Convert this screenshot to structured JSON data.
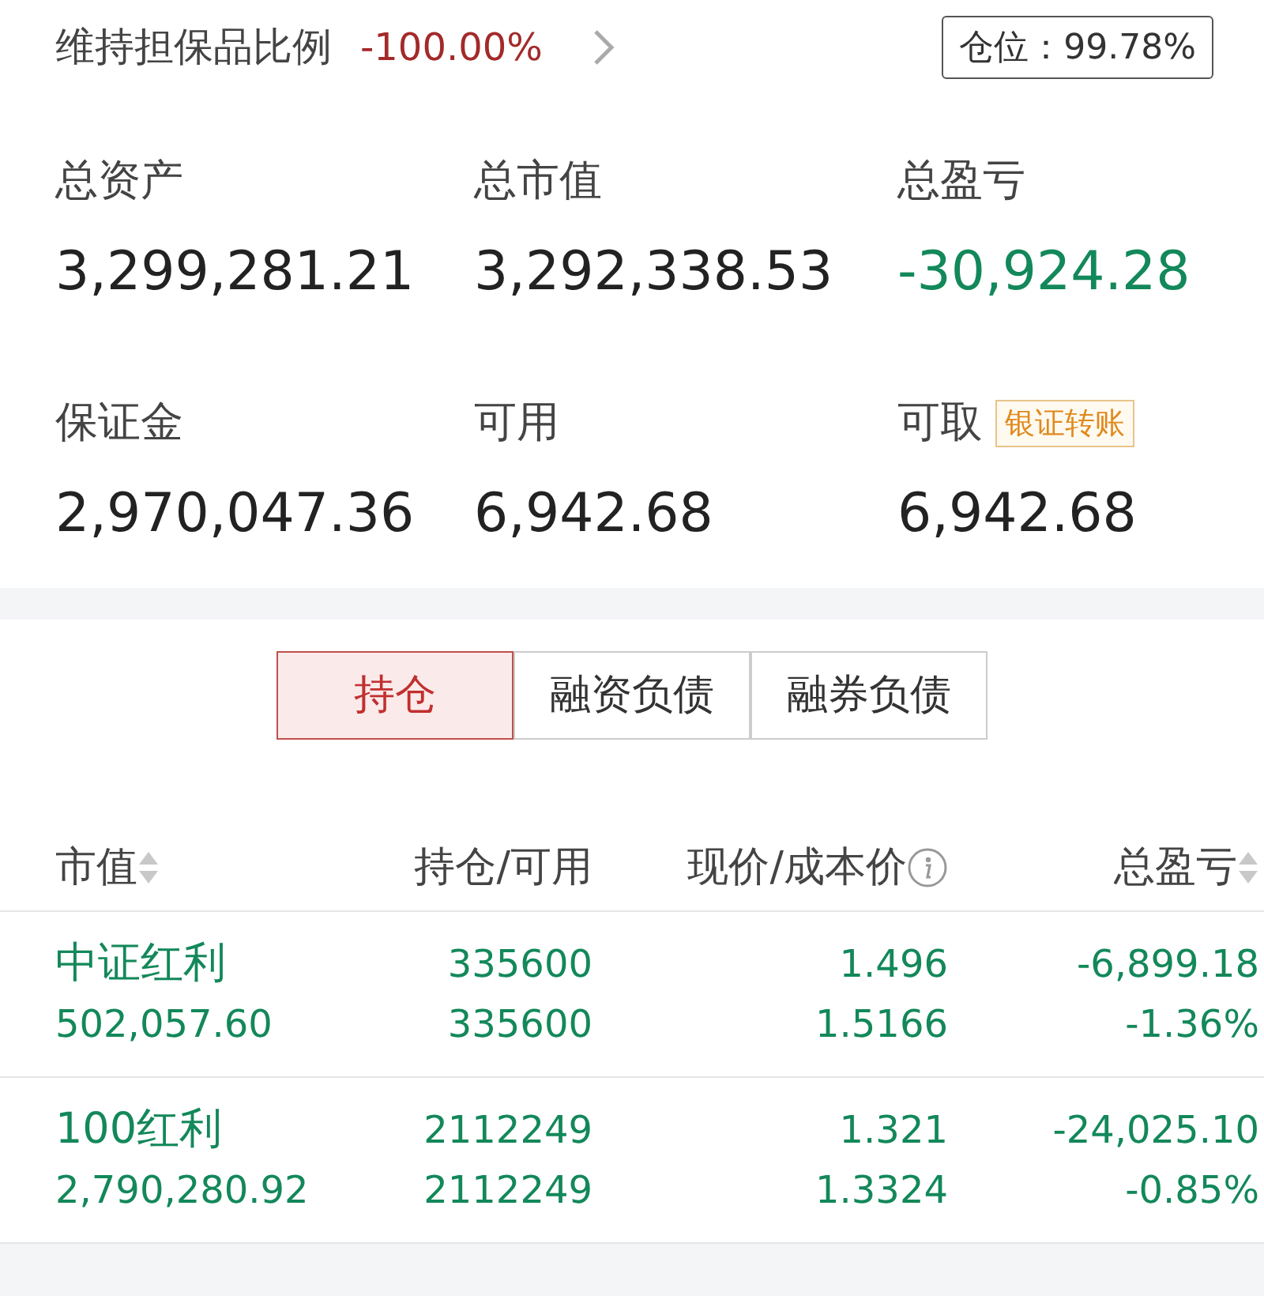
{
  "margin_ratio": {
    "label": "维持担保品比例",
    "value": "-100.00%"
  },
  "position_badge": "仓位：99.78%",
  "summary": [
    {
      "label": "总资产",
      "value": "3,299,281.21",
      "color": "#222222"
    },
    {
      "label": "总市值",
      "value": "3,292,338.53",
      "color": "#222222"
    },
    {
      "label": "总盈亏",
      "value": "-30,924.28",
      "color": "#13885a"
    },
    {
      "label": "保证金",
      "value": "2,970,047.36",
      "color": "#222222"
    },
    {
      "label": "可用",
      "value": "6,942.68",
      "color": "#222222"
    },
    {
      "label": "可取",
      "value": "6,942.68",
      "color": "#222222",
      "action": "银证转账"
    }
  ],
  "tabs": [
    {
      "label": "持仓",
      "selected": true
    },
    {
      "label": "融资负债",
      "selected": false
    },
    {
      "label": "融券负债",
      "selected": false
    }
  ],
  "table": {
    "columns": [
      {
        "label": "市值",
        "sortable": true,
        "info": false
      },
      {
        "label": "持仓/可用",
        "sortable": false,
        "info": false
      },
      {
        "label": "现价/成本价",
        "sortable": false,
        "info": true
      },
      {
        "label": "总盈亏",
        "sortable": true,
        "info": false
      }
    ],
    "rows": [
      {
        "color": "#13885a",
        "cells": [
          [
            "中证红利",
            "502,057.60"
          ],
          [
            "335600",
            "335600"
          ],
          [
            "1.496",
            "1.5166"
          ],
          [
            "-6,899.18",
            "-1.36%"
          ]
        ]
      },
      {
        "color": "#13885a",
        "cells": [
          [
            "100红利",
            "2,790,280.92"
          ],
          [
            "2112249",
            "2112249"
          ],
          [
            "1.321",
            "1.3324"
          ],
          [
            "-24,025.10",
            "-0.85%"
          ]
        ]
      }
    ]
  }
}
